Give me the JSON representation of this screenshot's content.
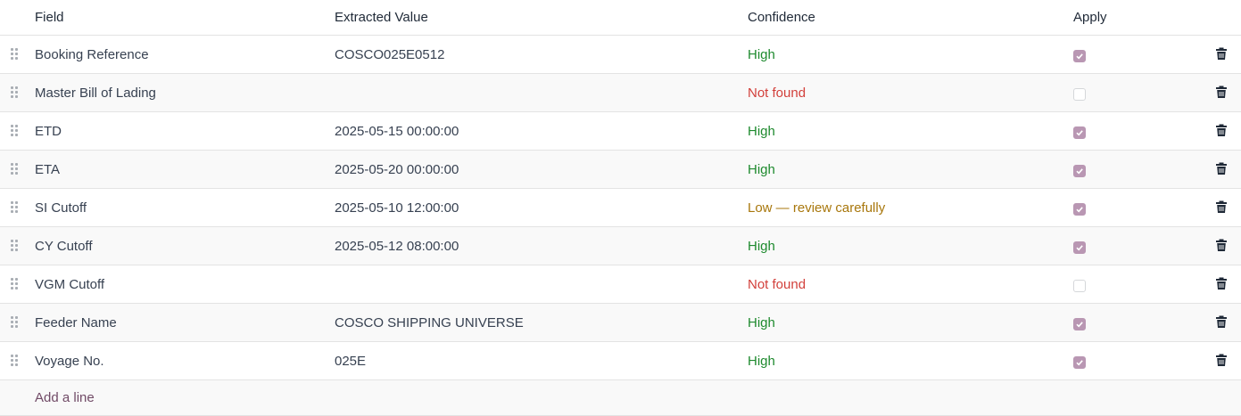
{
  "columns": {
    "field": "Field",
    "value": "Extracted Value",
    "confidence": "Confidence",
    "apply": "Apply"
  },
  "rows": [
    {
      "field": "Booking Reference",
      "value": "COSCO025E0512",
      "confidence": "High",
      "level": "high",
      "apply": true
    },
    {
      "field": "Master Bill of Lading",
      "value": "",
      "confidence": "Not found",
      "level": "none",
      "apply": false
    },
    {
      "field": "ETD",
      "value": "2025-05-15 00:00:00",
      "confidence": "High",
      "level": "high",
      "apply": true
    },
    {
      "field": "ETA",
      "value": "2025-05-20 00:00:00",
      "confidence": "High",
      "level": "high",
      "apply": true
    },
    {
      "field": "SI Cutoff",
      "value": "2025-05-10 12:00:00",
      "confidence": "Low — review carefully",
      "level": "low",
      "apply": true
    },
    {
      "field": "CY Cutoff",
      "value": "2025-05-12 08:00:00",
      "confidence": "High",
      "level": "high",
      "apply": true
    },
    {
      "field": "VGM Cutoff",
      "value": "",
      "confidence": "Not found",
      "level": "none",
      "apply": false
    },
    {
      "field": "Feeder Name",
      "value": "COSCO SHIPPING UNIVERSE",
      "confidence": "High",
      "level": "high",
      "apply": true
    },
    {
      "field": "Voyage No.",
      "value": "025E",
      "confidence": "High",
      "level": "high",
      "apply": true
    }
  ],
  "add_line": "Add a line",
  "icons": {
    "drag": "drag-handle-icon",
    "delete": "trash-icon",
    "check": "checkmark-icon"
  },
  "colors": {
    "high": "#1e8a2e",
    "not_found": "#d23f3a",
    "low": "#a8770c",
    "checkbox": "#b997b3",
    "link": "#714b67"
  }
}
